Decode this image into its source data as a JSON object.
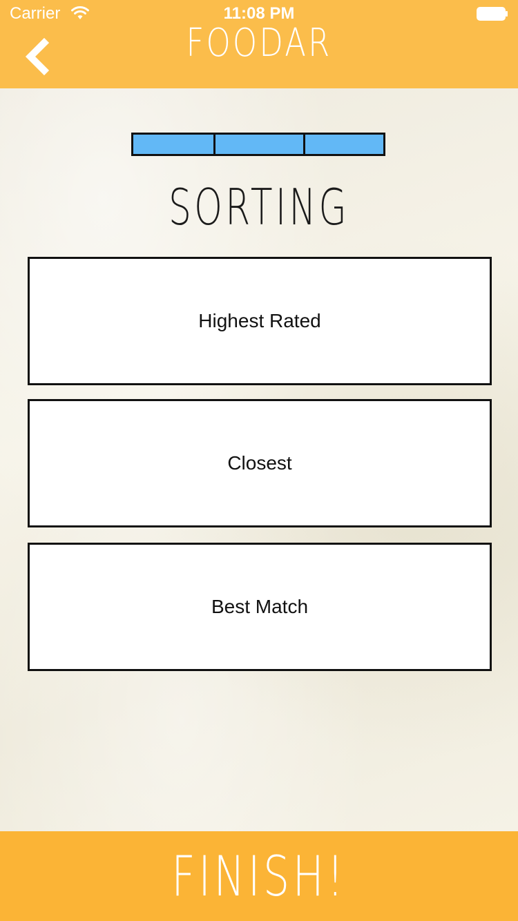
{
  "status_bar": {
    "carrier": "Carrier",
    "time": "11:08 PM",
    "wifi_icon": "wifi-icon",
    "battery_icon": "battery-icon"
  },
  "header": {
    "title": "FOODAR",
    "back_icon": "chevron-left-icon",
    "background_color": "#fbbd4b"
  },
  "progress": {
    "segments": 3,
    "filled": 3,
    "fill_color": "#62b8f6"
  },
  "section": {
    "title": "SORTING"
  },
  "options": [
    {
      "label": "Highest Rated"
    },
    {
      "label": "Closest"
    },
    {
      "label": "Best Match"
    }
  ],
  "footer": {
    "finish_label": "FINISH!",
    "background_color": "#fbb436"
  }
}
